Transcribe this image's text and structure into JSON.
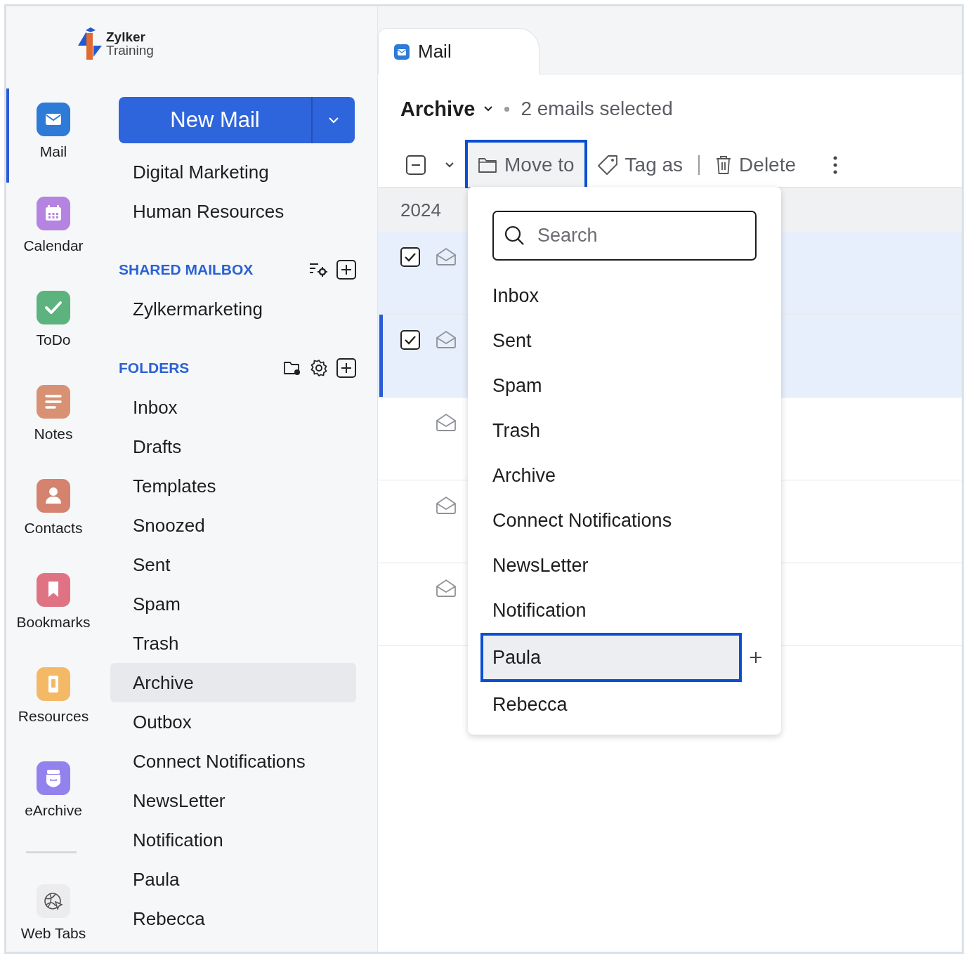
{
  "logo": {
    "name": "Zylker",
    "subtitle": "Training"
  },
  "apps": [
    {
      "label": "Mail",
      "kind": "mail",
      "color": "#2d7bd6",
      "selected": true
    },
    {
      "label": "Calendar",
      "kind": "calendar",
      "color": "#b583e0",
      "selected": false
    },
    {
      "label": "ToDo",
      "kind": "todo",
      "color": "#5db37e",
      "selected": false
    },
    {
      "label": "Notes",
      "kind": "notes",
      "color": "#d99174",
      "selected": false
    },
    {
      "label": "Contacts",
      "kind": "contacts",
      "color": "#d5826f",
      "selected": false
    },
    {
      "label": "Bookmarks",
      "kind": "bookmarks",
      "color": "#e07383",
      "selected": false
    },
    {
      "label": "Resources",
      "kind": "resources",
      "color": "#f4b967",
      "selected": false
    },
    {
      "label": "eArchive",
      "kind": "earchive",
      "color": "#9382ee",
      "selected": false
    }
  ],
  "pinned_apps": [
    {
      "label": "Web Tabs",
      "kind": "webtabs",
      "color": "#ececee",
      "selected": false
    }
  ],
  "new_mail": {
    "label": "New Mail"
  },
  "mailboxes": [
    {
      "label": "Digital Marketing",
      "selected": false
    },
    {
      "label": "Human Resources",
      "selected": false
    }
  ],
  "shared_mailbox": {
    "title": "SHARED MAILBOX",
    "items": [
      {
        "label": "Zylkermarketing",
        "selected": false
      }
    ]
  },
  "folders": {
    "title": "FOLDERS",
    "items": [
      {
        "label": "Inbox",
        "selected": false
      },
      {
        "label": "Drafts",
        "selected": false
      },
      {
        "label": "Templates",
        "selected": false
      },
      {
        "label": "Snoozed",
        "selected": false
      },
      {
        "label": "Sent",
        "selected": false
      },
      {
        "label": "Spam",
        "selected": false
      },
      {
        "label": "Trash",
        "selected": false
      },
      {
        "label": "Archive",
        "selected": true
      },
      {
        "label": "Outbox",
        "selected": false
      },
      {
        "label": "Connect Notifications",
        "selected": false
      },
      {
        "label": "NewsLetter",
        "selected": false
      },
      {
        "label": "Notification",
        "selected": false
      },
      {
        "label": "Paula",
        "selected": false
      },
      {
        "label": "Rebecca",
        "selected": false
      }
    ]
  },
  "tab": {
    "label": "Mail"
  },
  "header": {
    "folder": "Archive",
    "selection": "2 emails selected"
  },
  "toolbar": {
    "select_all_partial": true,
    "move_to": "Move to",
    "move_to_active": true,
    "tag_as": "Tag as",
    "delete": "Delete"
  },
  "group": {
    "label": "2024"
  },
  "emails": [
    {
      "checked": true,
      "selected": true,
      "focused": false
    },
    {
      "checked": true,
      "selected": true,
      "focused": true
    },
    {
      "checked": false,
      "selected": false,
      "focused": false
    },
    {
      "checked": false,
      "selected": false,
      "focused": false
    },
    {
      "checked": false,
      "selected": false,
      "focused": false
    }
  ],
  "move_menu": {
    "search": {
      "placeholder": "Search"
    },
    "items": [
      {
        "label": "Inbox",
        "selected": false
      },
      {
        "label": "Sent",
        "selected": false
      },
      {
        "label": "Spam",
        "selected": false
      },
      {
        "label": "Trash",
        "selected": false
      },
      {
        "label": "Archive",
        "selected": false
      },
      {
        "label": "Connect Notifications",
        "selected": false
      },
      {
        "label": "NewsLetter",
        "selected": false
      },
      {
        "label": "Notification",
        "selected": false
      },
      {
        "label": "Paula",
        "selected": true
      },
      {
        "label": "Rebecca",
        "selected": false
      }
    ]
  }
}
